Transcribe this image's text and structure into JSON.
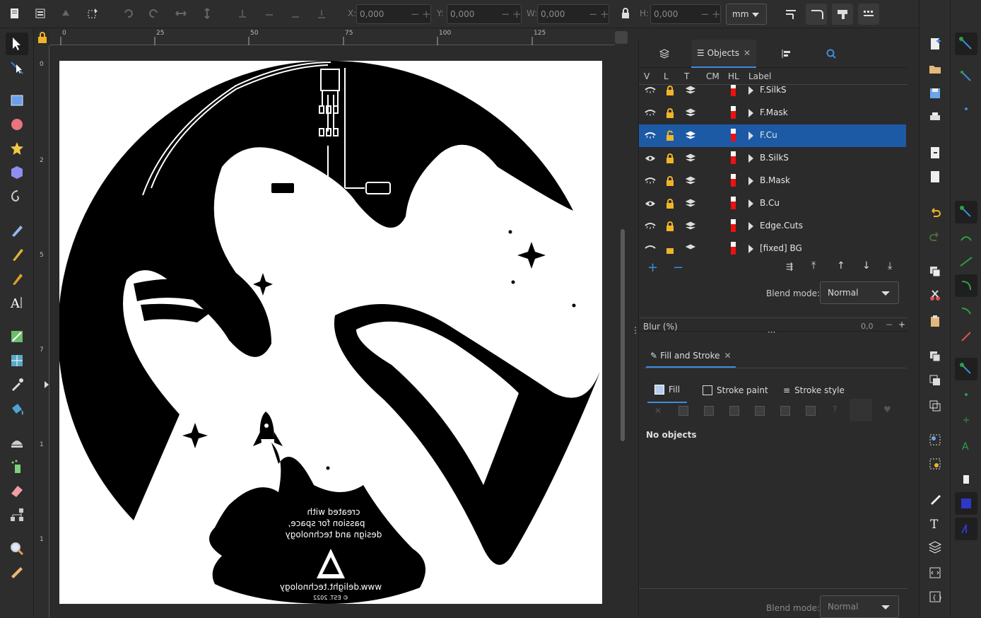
{
  "toolbar": {
    "x_label": "X:",
    "x_value": "0,000",
    "y_label": "Y:",
    "y_value": "0,000",
    "w_label": "W:",
    "w_value": "0,000",
    "h_label": "H:",
    "h_value": "0,000",
    "unit": "mm"
  },
  "ruler": {
    "h_ticks": [
      "0",
      "25",
      "50",
      "75",
      "100",
      "125"
    ],
    "v_ticks": [
      "0",
      "2",
      "5",
      "7",
      "1",
      "1"
    ]
  },
  "artwork": {
    "text_line1": "created with",
    "text_line2": "passion for space,",
    "text_line3": "design and technology",
    "url": "www.delight.technology",
    "est": "© EST. 2022"
  },
  "dock": {
    "objects_tab": "Objects",
    "columns": [
      "V",
      "L",
      "T",
      "CM",
      "HL",
      "Label"
    ],
    "layers": [
      {
        "label": "F.SilkS",
        "selected": false
      },
      {
        "label": "F.Mask",
        "selected": false
      },
      {
        "label": "F.Cu",
        "selected": true
      },
      {
        "label": "B.SilkS",
        "selected": false
      },
      {
        "label": "B.Mask",
        "selected": false
      },
      {
        "label": "B.Cu",
        "selected": false
      },
      {
        "label": "Edge.Cuts",
        "selected": false
      },
      {
        "label": "[fixed] BG",
        "selected": false
      }
    ],
    "blend_label": "Blend mode:",
    "blend_value": "Normal",
    "blur_label": "Blur (%)",
    "blur_value": "0,0",
    "fill_stroke_tab": "Fill and Stroke",
    "fill_tab": "Fill",
    "stroke_paint_tab": "Stroke paint",
    "stroke_style_tab": "Stroke style",
    "no_objects": "No objects",
    "blend_label_bottom": "Blend mode:",
    "blend_value_bottom": "Normal"
  },
  "colors": {
    "accent": "#1c5aa6",
    "tab_underline": "#3b8be0",
    "highlight_red": "#e11111"
  }
}
